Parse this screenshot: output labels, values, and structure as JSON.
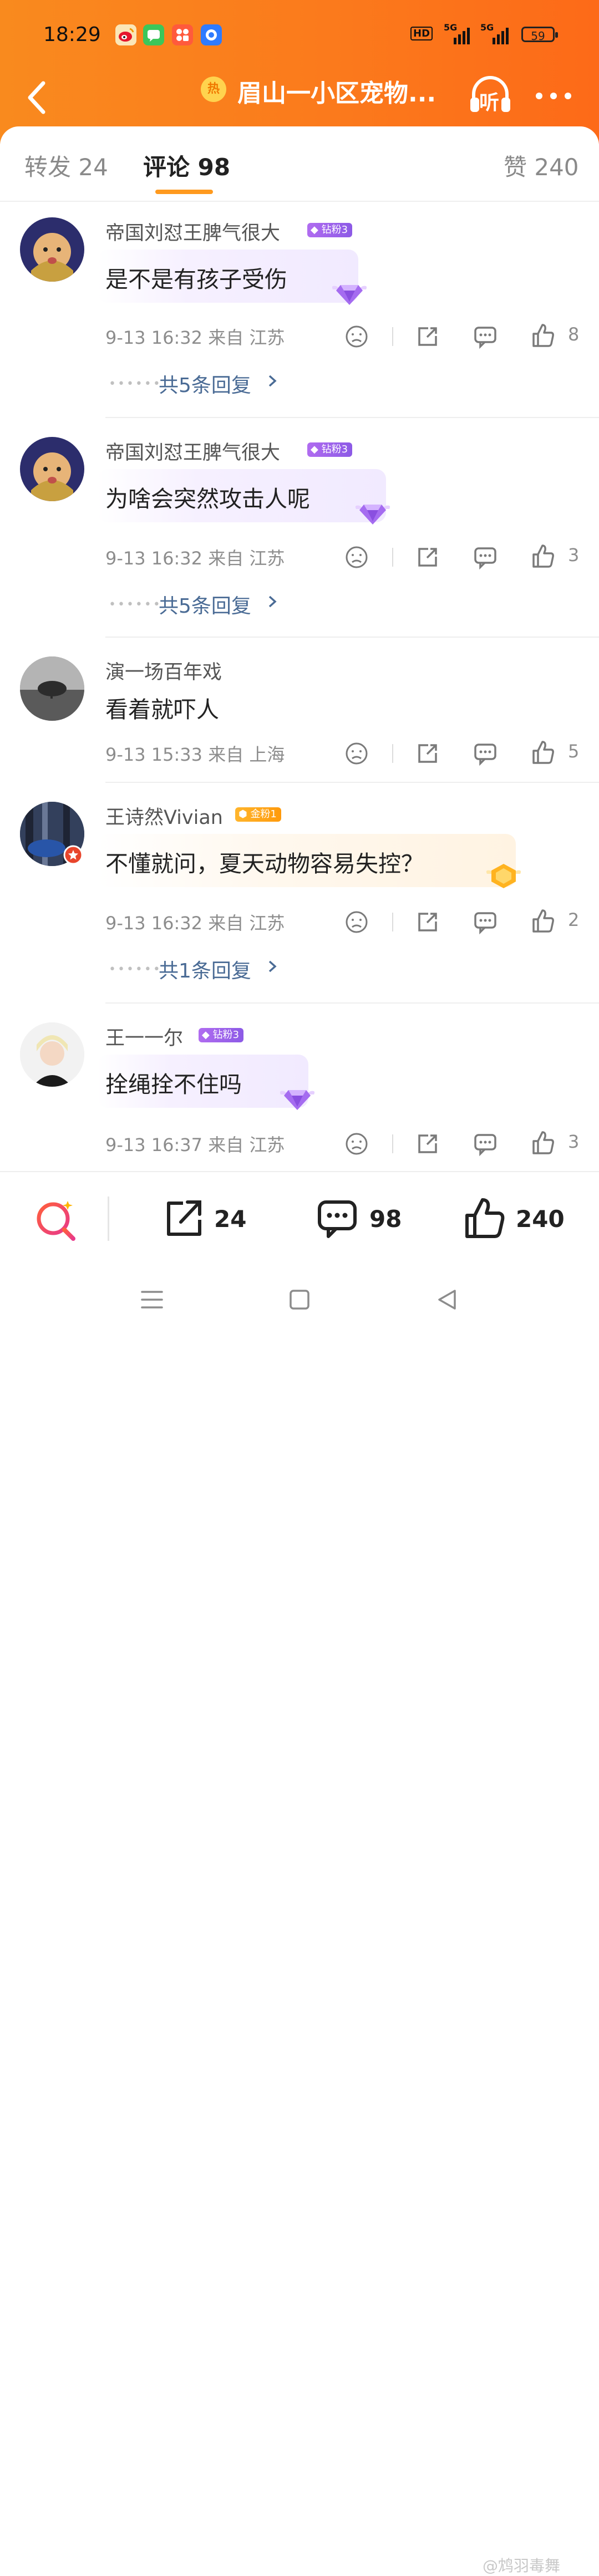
{
  "status_bar": {
    "time": "18:29",
    "app_icons": [
      "weibo-icon",
      "messages-icon",
      "toolbox-icon",
      "browser-icon"
    ],
    "hd_label": "HD",
    "network_1": "5G",
    "network_2": "5G",
    "battery": "59"
  },
  "nav": {
    "hot_label": "热",
    "title": "眉山一小区宠物...",
    "listen_label": "听"
  },
  "tabs": {
    "repost": "转发 24",
    "comment": "评论 98",
    "like": "赞 240"
  },
  "comments": [
    {
      "user": "帝国刘怼王脾气很大",
      "badge": "钻粉3",
      "text": "是不是有孩子受伤",
      "date": "9-13 16:32",
      "location": "来自 江苏",
      "likes": "8",
      "replies": "共5条回复"
    },
    {
      "user": "帝国刘怼王脾气很大",
      "badge": "钻粉3",
      "text": "为啥会突然攻击人呢",
      "date": "9-13 16:32",
      "location": "来自 江苏",
      "likes": "3",
      "replies": "共5条回复"
    },
    {
      "user": "演一场百年戏",
      "badge": "",
      "text": "看着就吓人",
      "date": "9-13 15:33",
      "location": "来自 上海",
      "likes": "5",
      "replies": ""
    },
    {
      "user": "王诗然Vivian",
      "badge": "金粉1",
      "text": "不懂就问，夏天动物容易失控？",
      "date": "9-13 16:32",
      "location": "来自 江苏",
      "likes": "2",
      "replies": "共1条回复"
    },
    {
      "user": "王一一尔",
      "badge": "钻粉3",
      "text": "拴绳拴不住吗",
      "date": "9-13 16:37",
      "location": "来自 江苏",
      "likes": "3",
      "replies": ""
    }
  ],
  "bottom_bar": {
    "repost_count": "24",
    "comment_count": "98",
    "like_count": "240"
  },
  "watermark": "@鸩羽毒舞",
  "colors": {
    "header_orange": "#fb7a1c",
    "tab_underline": "#ff9a1e",
    "reply_link": "#4a6b95",
    "badge_purple": "#9b5ee8",
    "badge_gold": "#ffa51a"
  }
}
